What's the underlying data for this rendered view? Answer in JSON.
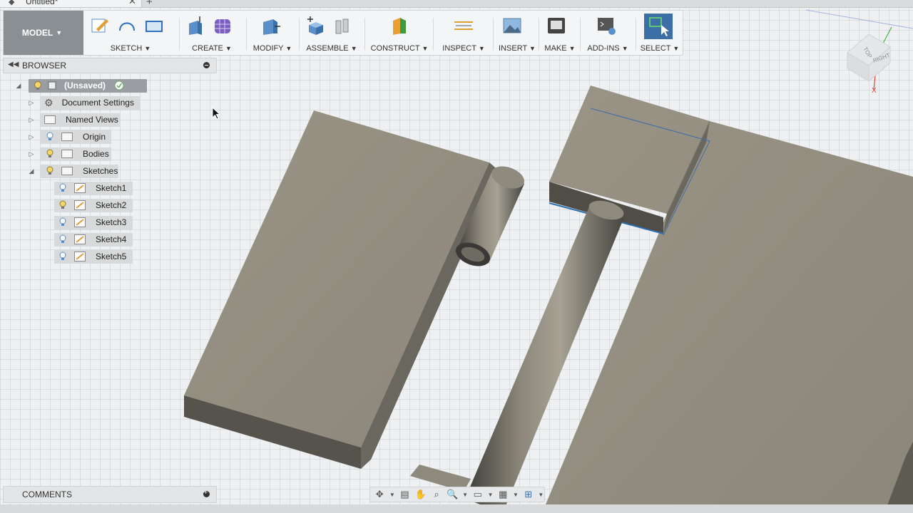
{
  "document": {
    "title": "Untitled*"
  },
  "toolbar": {
    "workspace": "MODEL",
    "groups": [
      {
        "label": "SKETCH"
      },
      {
        "label": "CREATE"
      },
      {
        "label": "MODIFY"
      },
      {
        "label": "ASSEMBLE"
      },
      {
        "label": "CONSTRUCT"
      },
      {
        "label": "INSPECT"
      },
      {
        "label": "INSERT"
      },
      {
        "label": "MAKE"
      },
      {
        "label": "ADD-INS"
      },
      {
        "label": "SELECT"
      }
    ]
  },
  "browser": {
    "title": "BROWSER",
    "root": "(Unsaved)",
    "items": [
      {
        "label": "Document Settings"
      },
      {
        "label": "Named Views"
      },
      {
        "label": "Origin"
      },
      {
        "label": "Bodies"
      },
      {
        "label": "Sketches"
      }
    ],
    "sketches": [
      "Sketch1",
      "Sketch2",
      "Sketch3",
      "Sketch4",
      "Sketch5"
    ]
  },
  "comments": {
    "title": "COMMENTS"
  },
  "viewcube": {
    "top": "TOP",
    "right": "RIGHT"
  },
  "colors": {
    "accent": "#3b6fa6",
    "body": "#8f8a7e",
    "select": "#2f6fb3"
  }
}
